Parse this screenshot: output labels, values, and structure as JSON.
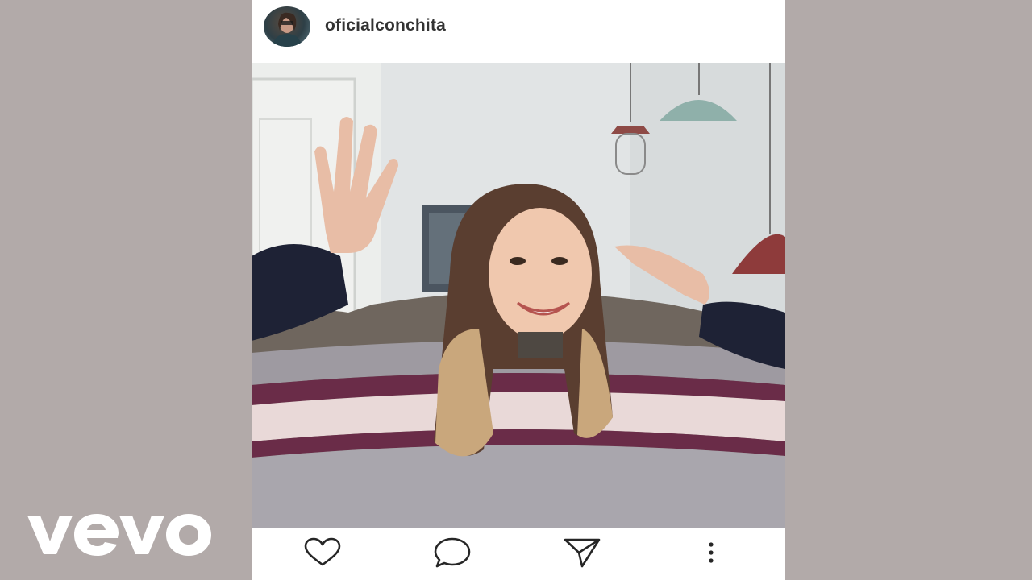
{
  "post": {
    "username": "oficialconchita",
    "avatar_icon": "avatar-image"
  },
  "actions": {
    "like_icon": "heart-icon",
    "comment_icon": "comment-bubble-icon",
    "share_icon": "paper-plane-icon",
    "more_icon": "more-vertical-icon"
  },
  "watermark": {
    "logo_text": "vevo"
  },
  "colors": {
    "background": "#b2aaa9",
    "card": "#ffffff",
    "username_text": "#333333",
    "icon_stroke": "#262626"
  }
}
